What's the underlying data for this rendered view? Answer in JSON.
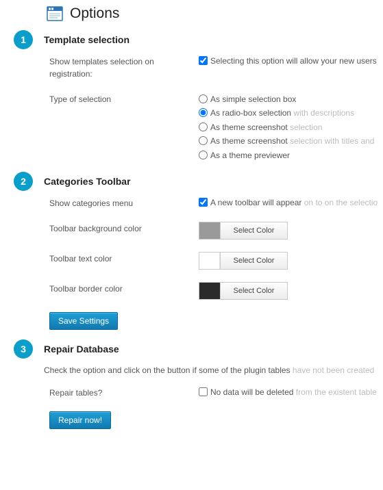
{
  "page_title": "Options",
  "sections": {
    "template": {
      "badge": "1",
      "title": "Template selection",
      "show_templates_label": "Show templates selection on registration:",
      "show_templates_desc": "Selecting this option will allow your new users",
      "type_label": "Type of selection",
      "options": [
        {
          "label_a": "As simple selection box",
          "label_b": ""
        },
        {
          "label_a": "As radio-box selection",
          "label_b": " with descriptions"
        },
        {
          "label_a": "As theme screenshot",
          "label_b": " selection"
        },
        {
          "label_a": "As theme screenshot",
          "label_b": " selection with titles and"
        },
        {
          "label_a": "As a theme previewer",
          "label_b": ""
        }
      ],
      "selected_index": 1
    },
    "categories": {
      "badge": "2",
      "title": "Categories Toolbar",
      "menu_label": "Show categories menu",
      "menu_desc_a": "A new toolbar will appear",
      "menu_desc_b": " on to on the selectio",
      "bg_label": "Toolbar background color",
      "txt_label": "Toolbar text color",
      "brd_label": "Toolbar border color",
      "select_color": "Select Color",
      "save_btn": "Save Settings"
    },
    "repair": {
      "badge": "3",
      "title": "Repair Database",
      "desc_a": "Check the option and click on the button if some of the plugin tables",
      "desc_b": " have not been created",
      "tables_label": "Repair tables?",
      "tables_desc_a": "No data will be deleted",
      "tables_desc_b": " from the existent table",
      "repair_btn": "Repair now!"
    }
  }
}
